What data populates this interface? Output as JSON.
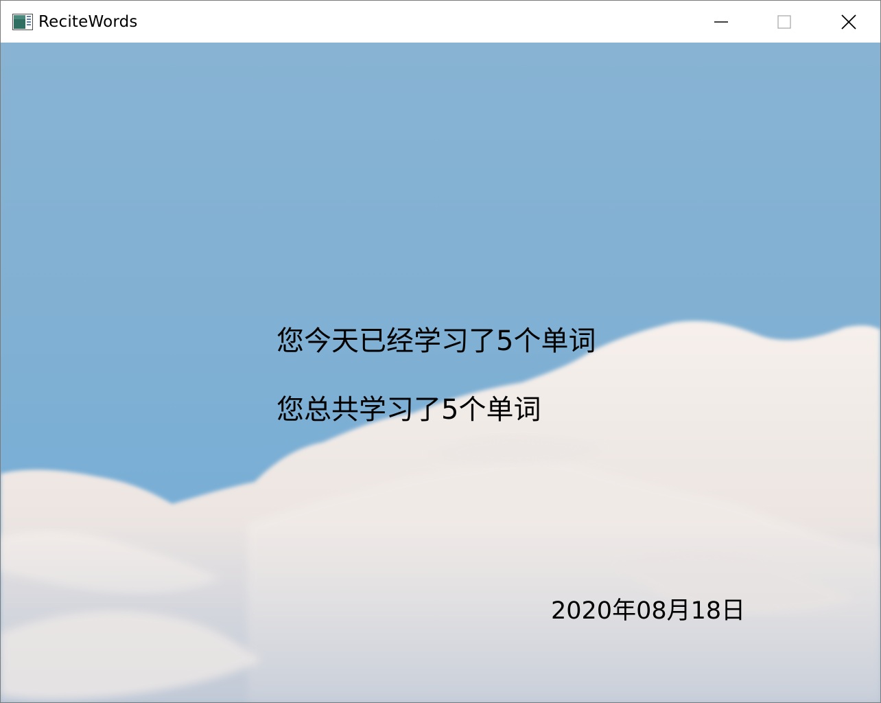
{
  "window": {
    "title": "ReciteWords",
    "controls": {
      "minimize_icon": "minimize-icon",
      "maximize_icon": "maximize-icon",
      "close_icon": "close-icon"
    }
  },
  "stats": {
    "today_text": "您今天已经学习了5个单词",
    "total_text": "您总共学习了5个单词",
    "date_text": "2020年08月18日"
  },
  "colors": {
    "sky_top": "#87b2d3",
    "sky_mid": "#7fb0d4",
    "cloud": "#f3ede9",
    "text": "#000000"
  }
}
